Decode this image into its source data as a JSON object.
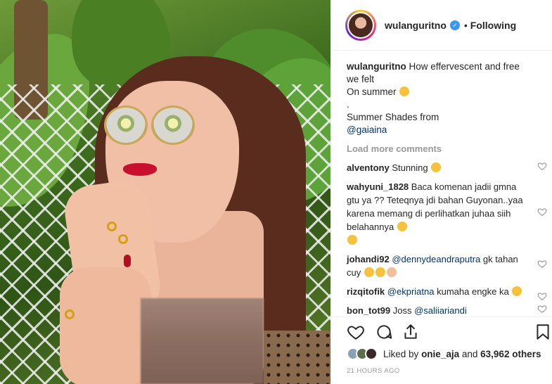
{
  "post": {
    "username": "wulanguritno",
    "verified_icon": "verified-badge-icon",
    "follow_state": "Following",
    "separator": "•"
  },
  "caption": {
    "username": "wulanguritno",
    "line1": "How effervescent and free we felt",
    "line2": "On summer",
    "line3": ".",
    "line4": "Summer Shades from",
    "mention": "@gaiaina"
  },
  "load_more": "Load more comments",
  "comments": [
    {
      "user": "alventony",
      "text": "Stunning",
      "emoji": "thumbs-up"
    },
    {
      "user": "wahyuni_1828",
      "text": "Baca komenan jadii gmna gtu ya ?? Teteqnya jdi bahan Guyonan..yaa karena memang di perlihatkan juhaa siih belahannya",
      "emoji": "laughing"
    },
    {
      "user": "johandi92",
      "mention": "@dennydeandraputra",
      "text": "gk tahan cuy",
      "emoji": "laughing-heart-eyes-thumbs-up"
    },
    {
      "user": "rizqitofik",
      "mention": "@ekpriatna",
      "text": "kumaha engke ka",
      "emoji": "rofl"
    },
    {
      "user": "bon_tot99",
      "text": "Joss",
      "mention": "@saliiariandi"
    }
  ],
  "likes": {
    "prefix": "Liked by",
    "user": "onie_aja",
    "middle": "and",
    "count": "63,962 others"
  },
  "timestamp": "21 HOURS AGO",
  "icons": {
    "like": "heart-icon",
    "comment": "comment-icon",
    "share": "share-icon",
    "save": "bookmark-icon"
  },
  "colors": {
    "link": "#003569",
    "muted": "#999999",
    "verified": "#3897f0"
  }
}
